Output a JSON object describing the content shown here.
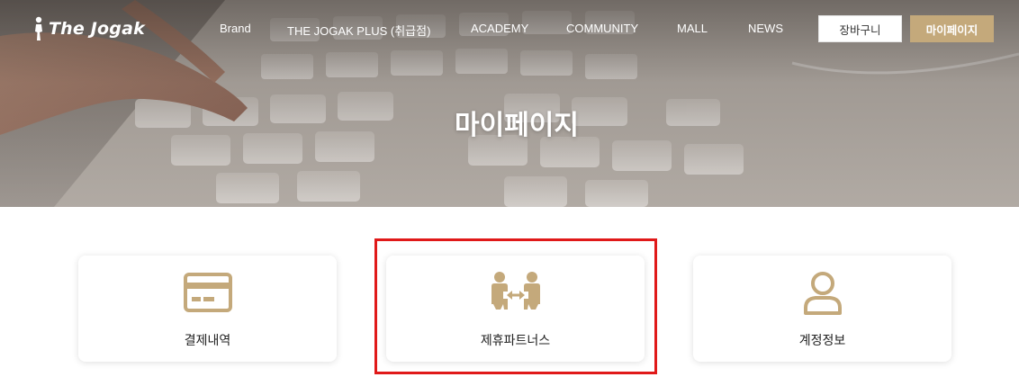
{
  "header": {
    "logo_text": "The Jogak",
    "nav": [
      {
        "label": "Brand"
      },
      {
        "label": "THE JOGAK PLUS (취급점)"
      },
      {
        "label": "ACADEMY"
      },
      {
        "label": "COMMUNITY"
      },
      {
        "label": "MALL"
      },
      {
        "label": "NEWS"
      }
    ],
    "cart_button": "장바구니",
    "mypage_button": "마이페이지"
  },
  "hero": {
    "title": "마이페이지"
  },
  "cards": [
    {
      "label": "결제내역",
      "icon": "credit-card-icon"
    },
    {
      "label": "제휴파트너스",
      "icon": "partners-icon"
    },
    {
      "label": "계정정보",
      "icon": "user-icon"
    }
  ],
  "colors": {
    "accent": "#c4a97b",
    "highlight": "#e01919",
    "text": "#222222"
  }
}
